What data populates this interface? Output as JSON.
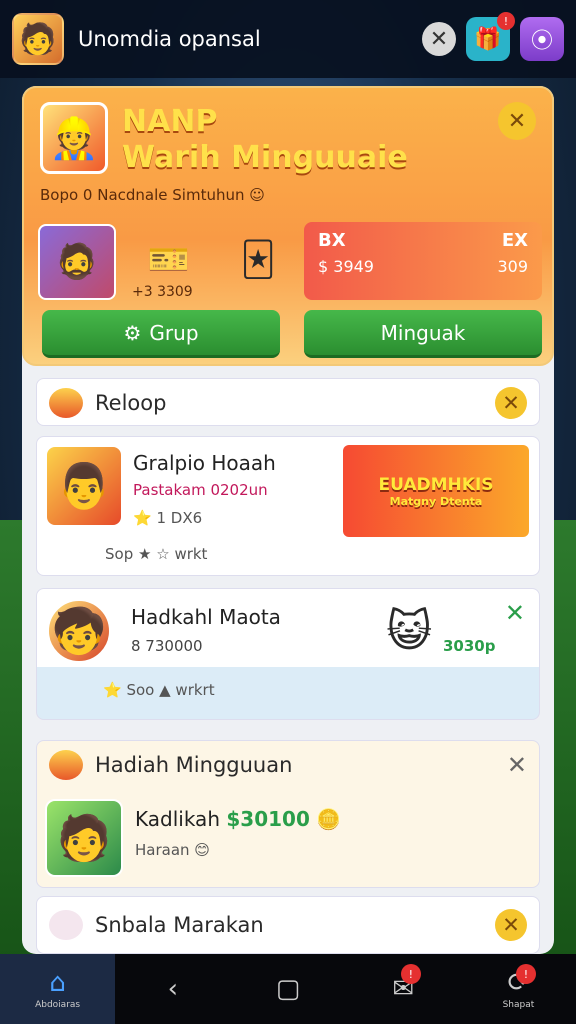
{
  "topbar": {
    "title": "Unomdia opansal",
    "close_icon": "close-icon",
    "gift_badge": "!",
    "coin_icon": "coin-icon"
  },
  "hero": {
    "title1": "NANP",
    "title2": "Warih Minguuaie",
    "subtitle": "Bopo 0 Nacdnale Simtuhun ☺",
    "items_value": "+3 3309",
    "stats": [
      {
        "label": "BX",
        "value": "$ 3949"
      },
      {
        "label": "EX",
        "value": "309"
      }
    ],
    "buttons": {
      "grup": "Grup",
      "minguak": "Minguak"
    }
  },
  "sections": {
    "reloop": "Reloop",
    "card1": {
      "title": "Gralpio Hoaah",
      "subtitle": "Pastakam 0202un",
      "meta": "1 DX6",
      "footer": "Sop",
      "footer2": "wrkt",
      "banner": "EUADMHKIS",
      "banner_sub": "Matgny Dtenta"
    },
    "card2": {
      "title": "Hadkahl Maota",
      "value": "8 730000",
      "footer": "Soo",
      "footer2": "wrkrt",
      "amount": "3030p"
    },
    "mingguan": {
      "title": "Hadiah Mingguuan",
      "reward_title": "Kadlikah",
      "reward_value": "$30100",
      "reward_sub": "Haraan"
    },
    "last": "Snbala Marakan"
  },
  "nav": {
    "items": [
      {
        "label": "Abdoiaras"
      },
      {
        "label": ""
      },
      {
        "label": ""
      },
      {
        "label": ""
      },
      {
        "label": "Shapat"
      }
    ],
    "badge": "!"
  }
}
